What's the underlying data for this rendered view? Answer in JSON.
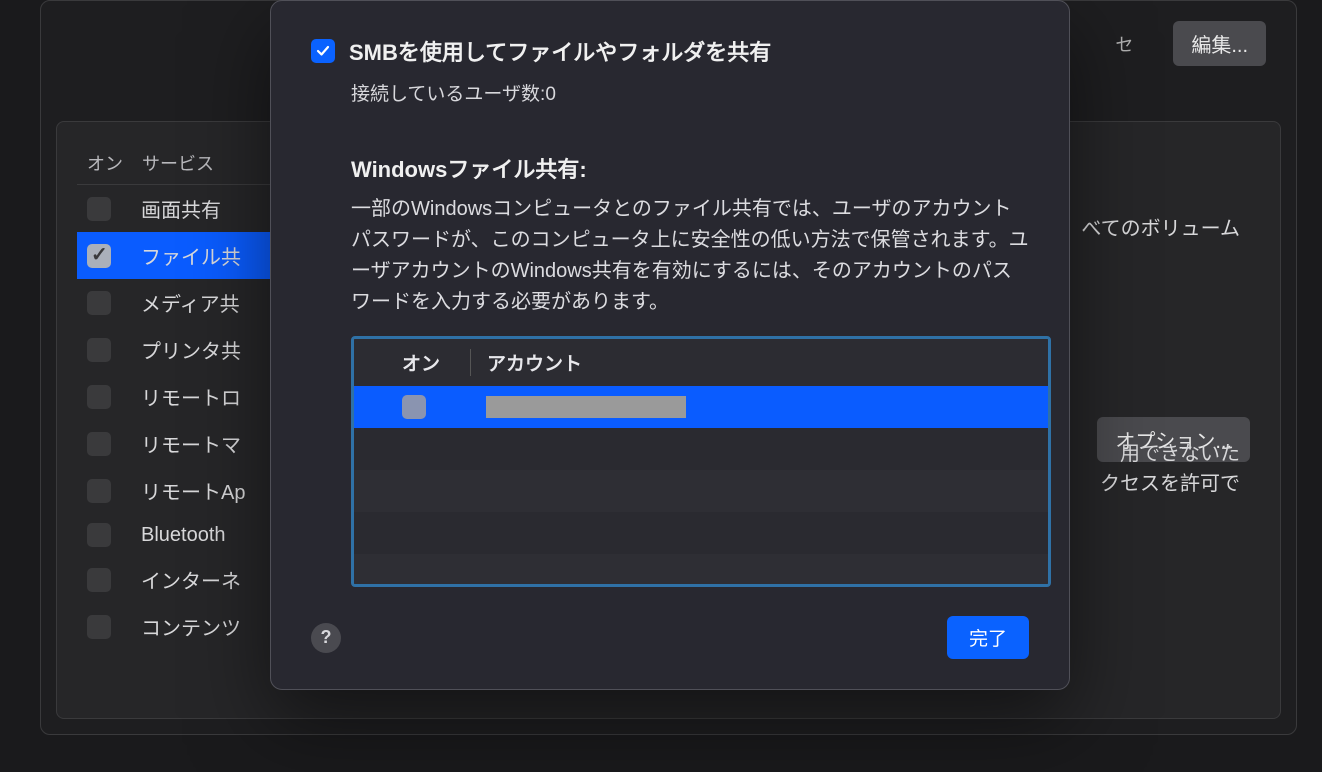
{
  "background": {
    "edit_button": "編集...",
    "top_trunc": "セ",
    "options_button": "オプション...",
    "vol_text": "べてのボリューム",
    "info_line1": "用できないた",
    "info_line2": "クセスを許可で",
    "sidebar": {
      "header_on": "オン",
      "header_service": "サービス",
      "items": [
        {
          "label": "画面共有",
          "selected": false
        },
        {
          "label": "ファイル共",
          "selected": true
        },
        {
          "label": "メディア共",
          "selected": false
        },
        {
          "label": "プリンタ共",
          "selected": false
        },
        {
          "label": "リモートロ",
          "selected": false
        },
        {
          "label": "リモートマ",
          "selected": false
        },
        {
          "label": "リモートAp",
          "selected": false
        },
        {
          "label": "Bluetooth",
          "selected": false
        },
        {
          "label": "インターネ",
          "selected": false
        },
        {
          "label": "コンテンツ",
          "selected": false
        }
      ]
    }
  },
  "sheet": {
    "smb_label": "SMBを使用してファイルやフォルダを共有",
    "connected_users": "接続しているユーザ数:0",
    "windows_title": "Windowsファイル共有:",
    "windows_description": "一部のWindowsコンピュータとのファイル共有では、ユーザのアカウントパスワードが、このコンピュータ上に安全性の低い方法で保管されます。ユーザアカウントのWindows共有を有効にするには、そのアカウントのパスワードを入力する必要があります。",
    "table": {
      "header_on": "オン",
      "header_account": "アカウント"
    },
    "help_symbol": "?",
    "done_button": "完了"
  }
}
